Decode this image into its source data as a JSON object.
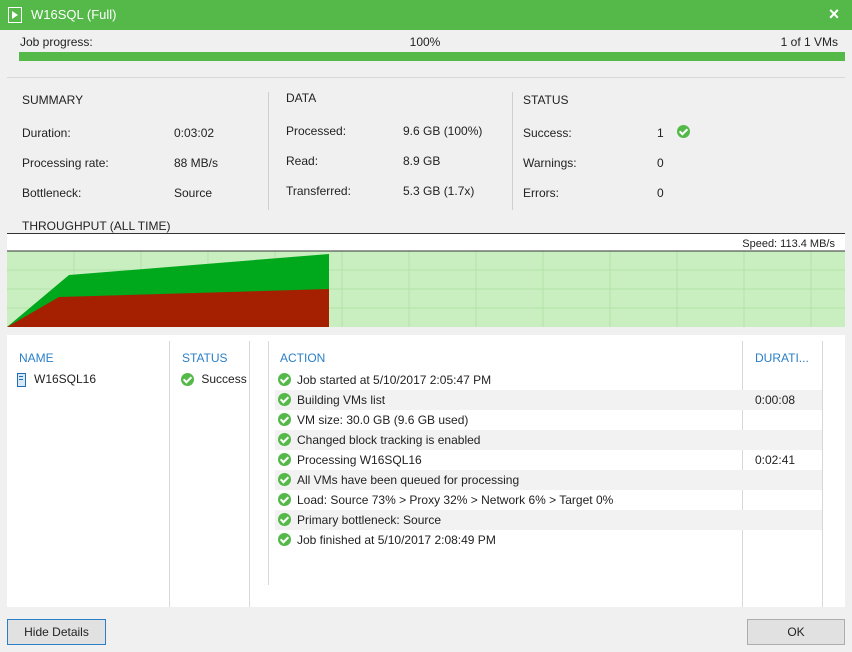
{
  "window": {
    "title": "W16SQL (Full)",
    "close_label": "×"
  },
  "progress": {
    "label": "Job progress:",
    "percent_text": "100%",
    "value": 100,
    "count_text": "1 of 1 VMs"
  },
  "summary": {
    "title": "SUMMARY",
    "rows": [
      {
        "label": "Duration:",
        "value": "0:03:02"
      },
      {
        "label": "Processing rate:",
        "value": "88 MB/s"
      },
      {
        "label": "Bottleneck:",
        "value": "Source"
      }
    ]
  },
  "data": {
    "title": "DATA",
    "rows": [
      {
        "label": "Processed:",
        "value": "9.6 GB (100%)"
      },
      {
        "label": "Read:",
        "value": "8.9 GB"
      },
      {
        "label": "Transferred:",
        "value": "5.3 GB (1.7x)"
      }
    ]
  },
  "status": {
    "title": "STATUS",
    "rows": [
      {
        "label": "Success:",
        "value": "1"
      },
      {
        "label": "Warnings:",
        "value": "0"
      },
      {
        "label": "Errors:",
        "value": "0"
      }
    ]
  },
  "throughput": {
    "title": "THROUGHPUT (ALL TIME)",
    "speed_text": "Speed: 113.4 MB/s"
  },
  "details": {
    "headers": {
      "name": "NAME",
      "status": "STATUS",
      "action": "ACTION",
      "duration": "DURATI..."
    },
    "vm": {
      "name": "W16SQL16",
      "status": "Success"
    },
    "actions": [
      {
        "text": "Job started at 5/10/2017 2:05:47 PM",
        "duration": ""
      },
      {
        "text": "Building VMs list",
        "duration": "0:00:08"
      },
      {
        "text": "VM size: 30.0 GB (9.6 GB used)",
        "duration": ""
      },
      {
        "text": "Changed block tracking is enabled",
        "duration": ""
      },
      {
        "text": "Processing W16SQL16",
        "duration": "0:02:41"
      },
      {
        "text": "All VMs have been queued for processing",
        "duration": ""
      },
      {
        "text": "Load: Source 73% > Proxy 32% > Network 6% > Target 0%",
        "duration": ""
      },
      {
        "text": "Primary bottleneck: Source",
        "duration": ""
      },
      {
        "text": "Job finished at 5/10/2017 2:08:49 PM",
        "duration": ""
      }
    ]
  },
  "buttons": {
    "hide_details": "Hide Details",
    "ok": "OK"
  },
  "colors": {
    "accent": "#54b948",
    "link_blue": "#2a7fc6",
    "read_area": "#009e1a",
    "transfer_area": "#a52000"
  }
}
